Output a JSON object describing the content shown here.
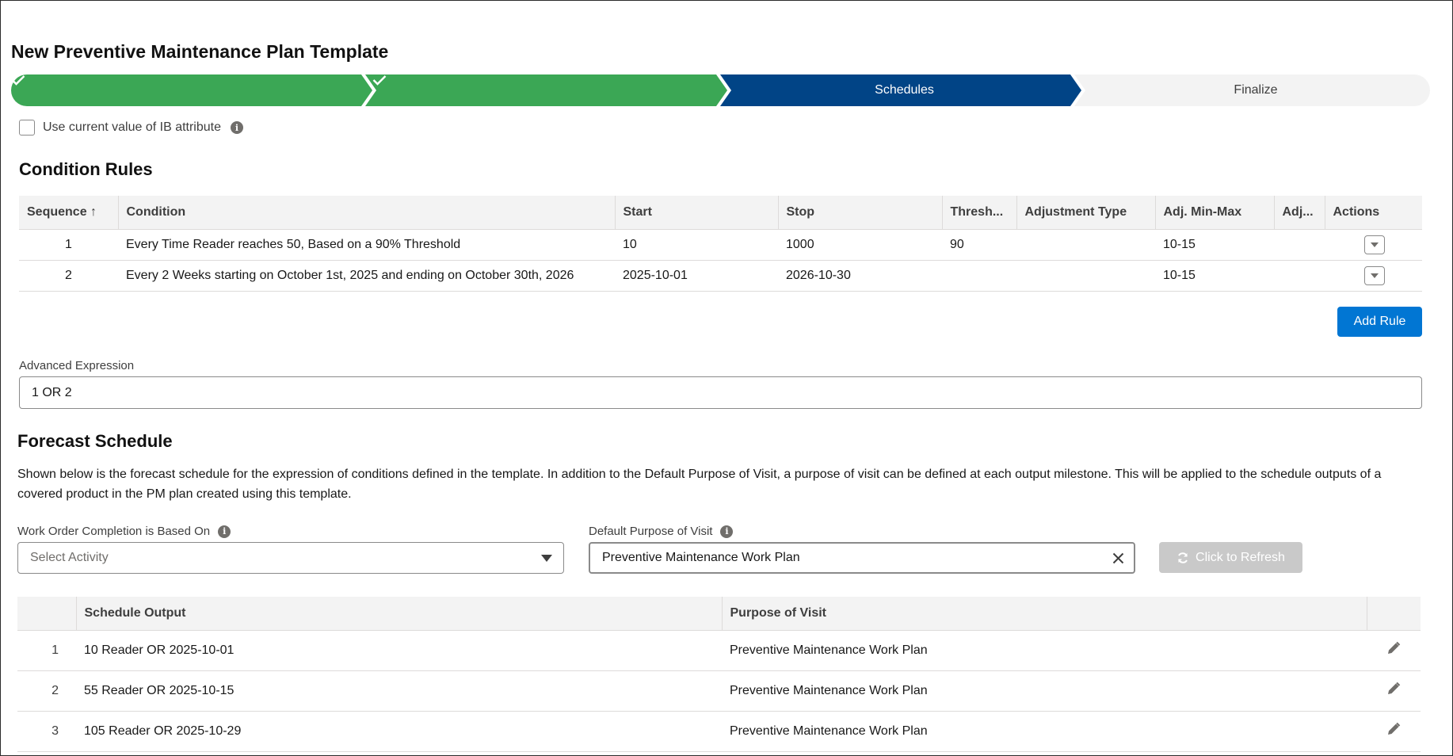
{
  "page": {
    "title": "New Preventive Maintenance Plan Template"
  },
  "path": {
    "steps": [
      {
        "label": "",
        "status": "complete",
        "icon": "check-icon"
      },
      {
        "label": "",
        "status": "complete",
        "icon": "check-icon"
      },
      {
        "label": "Schedules",
        "status": "current"
      },
      {
        "label": "Finalize",
        "status": "incomplete"
      }
    ],
    "colors": {
      "complete": "#3ba755",
      "current": "#014486",
      "incomplete": "#f3f3f3"
    }
  },
  "ib_option": {
    "label": "Use current value of IB attribute",
    "checked": false
  },
  "condition_rules": {
    "title": "Condition Rules",
    "columns": [
      "Sequence",
      "Condition",
      "Start",
      "Stop",
      "Thresh...",
      "Adjustment Type",
      "Adj. Min-Max",
      "Adj...",
      "Actions"
    ],
    "rows": [
      {
        "seq": "1",
        "condition": "Every Time Reader reaches 50, Based on a 90% Threshold",
        "start": "10",
        "stop": "1000",
        "threshold": "90",
        "adj_type": "",
        "adj_min_max": "10-15",
        "adj": ""
      },
      {
        "seq": "2",
        "condition": "Every 2 Weeks starting on October 1st, 2025 and ending on October 30th, 2026",
        "start": "2025-10-01",
        "stop": "2026-10-30",
        "threshold": "",
        "adj_type": "",
        "adj_min_max": "10-15",
        "adj": ""
      }
    ],
    "add_button": "Add Rule"
  },
  "advanced_expression": {
    "label": "Advanced Expression",
    "value": "1 OR 2"
  },
  "forecast": {
    "title": "Forecast Schedule",
    "description": "Shown below is the forecast schedule for the expression of conditions defined in the template. In addition to the Default Purpose of Visit, a purpose of visit can be defined at each output milestone. This will be applied to the schedule outputs of a covered product in the PM plan created using this template.",
    "work_order_label": "Work Order Completion is Based On",
    "work_order_placeholder": "Select Activity",
    "default_purpose_label": "Default Purpose of Visit",
    "default_purpose_value": "Preventive Maintenance Work Plan",
    "refresh_button": "Click to Refresh",
    "columns": [
      "Schedule Output",
      "Purpose of Visit"
    ],
    "rows": [
      {
        "n": "1",
        "output": "10 Reader OR 2025-10-01",
        "purpose": "Preventive Maintenance Work Plan"
      },
      {
        "n": "2",
        "output": "55 Reader OR 2025-10-15",
        "purpose": "Preventive Maintenance Work Plan"
      },
      {
        "n": "3",
        "output": "105 Reader OR 2025-10-29",
        "purpose": "Preventive Maintenance Work Plan"
      }
    ]
  },
  "colors": {
    "brand": "#0176d3",
    "disabled": "#c9c9c9"
  }
}
